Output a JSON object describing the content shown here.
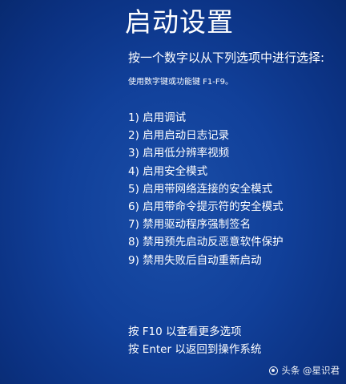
{
  "screen": {
    "title": "启动设置",
    "prompt": "按一个数字以从下列选项中进行选择:",
    "hint": "使用数字键或功能键 F1-F9。",
    "options": [
      "1) 启用调试",
      "2) 启用启动日志记录",
      "3) 启用低分辨率视频",
      "4) 启用安全模式",
      "5) 启用带网络连接的安全模式",
      "6) 启用带命令提示符的安全模式",
      "7) 禁用驱动程序强制签名",
      "8) 禁用预先启动反恶意软件保护",
      "9) 禁用失败后自动重新启动"
    ],
    "footer": {
      "more_options": "按 F10 以查看更多选项",
      "return_os": "按 Enter 以返回到操作系统"
    }
  },
  "watermark": {
    "text": "头条 @星识君",
    "icon": "circle-logo-icon"
  },
  "colors": {
    "background": "#11409a",
    "text": "#ffffff"
  }
}
